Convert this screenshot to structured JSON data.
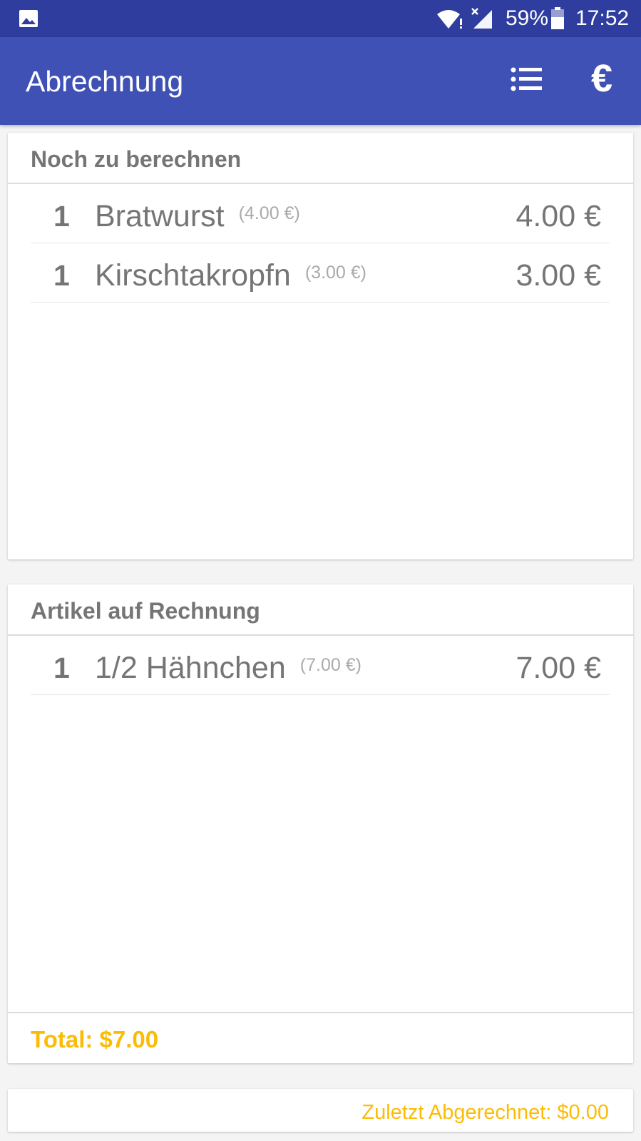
{
  "status_bar": {
    "battery_percent": "59%",
    "time": "17:52",
    "icons": [
      "gallery-icon",
      "wifi-icon",
      "signal-icon",
      "battery-icon"
    ]
  },
  "app_bar": {
    "title": "Abrechnung",
    "actions": [
      {
        "icon": "list-icon"
      },
      {
        "icon": "euro-icon",
        "glyph": "€"
      }
    ],
    "color": "#3f51b5"
  },
  "pending": {
    "header": "Noch zu berechnen",
    "items": [
      {
        "qty": "1",
        "name": "Bratwurst",
        "unit_price": "(4.00 €)",
        "total": "4.00 €"
      },
      {
        "qty": "1",
        "name": "Kirschtakropfn",
        "unit_price": "(3.00 €)",
        "total": "3.00 €"
      }
    ]
  },
  "invoice": {
    "header": "Artikel auf Rechnung",
    "items": [
      {
        "qty": "1",
        "name": "1/2 Hähnchen",
        "unit_price": "(7.00 €)",
        "total": "7.00 €"
      }
    ],
    "total": "Total: $7.00"
  },
  "footer": {
    "last_settled": "Zuletzt Abgerechnet: $0.00"
  },
  "colors": {
    "accent": "#fbbc05",
    "status_bar": "#2f3e9e",
    "text": "#757575"
  }
}
